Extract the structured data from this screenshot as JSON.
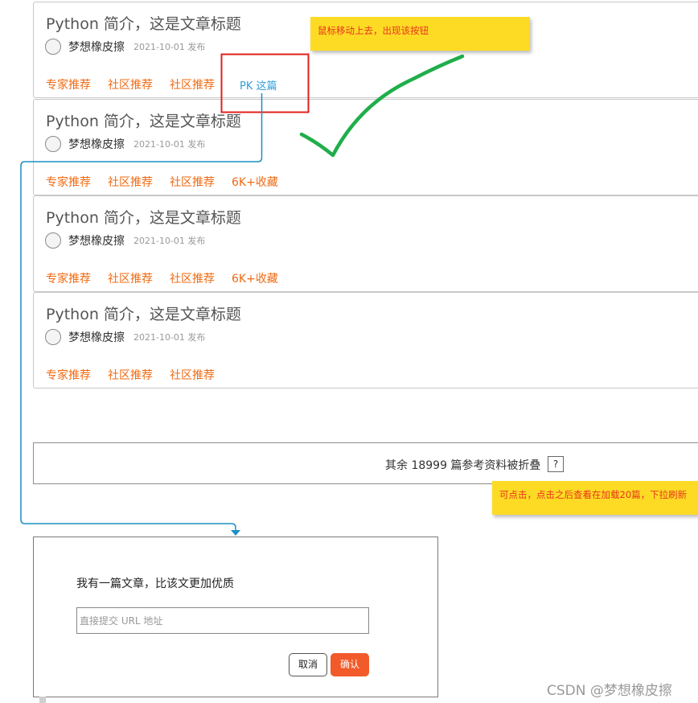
{
  "articles": [
    {
      "title": "Python 简介，这是文章标题",
      "author": "梦想橡皮擦",
      "date": "2021-10-01 发布",
      "tags": [
        "专家推荐",
        "社区推荐",
        "社区推荐"
      ],
      "extra_tag": "PK 这篇"
    },
    {
      "title": "Python 简介，这是文章标题",
      "author": "梦想橡皮擦",
      "date": "2021-10-01 发布",
      "tags": [
        "专家推荐",
        "社区推荐",
        "社区推荐",
        "6K+收藏"
      ]
    },
    {
      "title": "Python 简介，这是文章标题",
      "author": "梦想橡皮擦",
      "date": "2021-10-01 发布",
      "tags": [
        "专家推荐",
        "社区推荐",
        "社区推荐",
        "6K+收藏"
      ]
    },
    {
      "title": "Python 简介，这是文章标题",
      "author": "梦想橡皮擦",
      "date": "2021-10-01 发布",
      "tags": [
        "专家推荐",
        "社区推荐",
        "社区推荐"
      ]
    }
  ],
  "notes": {
    "hover": "鼠标移动上去，出现该按钮",
    "click": "可点击，点击之后查看在加载20篇，下拉刷新"
  },
  "collapse": {
    "text": "其余 18999 篇参考资料被折叠",
    "help_icon": "?"
  },
  "dialog": {
    "title": "我有一篇文章，比该文更加优质",
    "input_placeholder": "直接提交 URL 地址",
    "input_value": "",
    "cancel_label": "取消",
    "confirm_label": "确认"
  },
  "watermark": "CSDN @梦想橡皮擦",
  "colors": {
    "tag": "#f06a12",
    "pk_link": "#2f9fd8",
    "note_bg": "#fddb25",
    "note_text": "#e8341c",
    "highlight_box": "#e0201e",
    "checkmark": "#1fae4a",
    "connector": "#1b8fc4",
    "confirm_button": "#f25a2a"
  }
}
